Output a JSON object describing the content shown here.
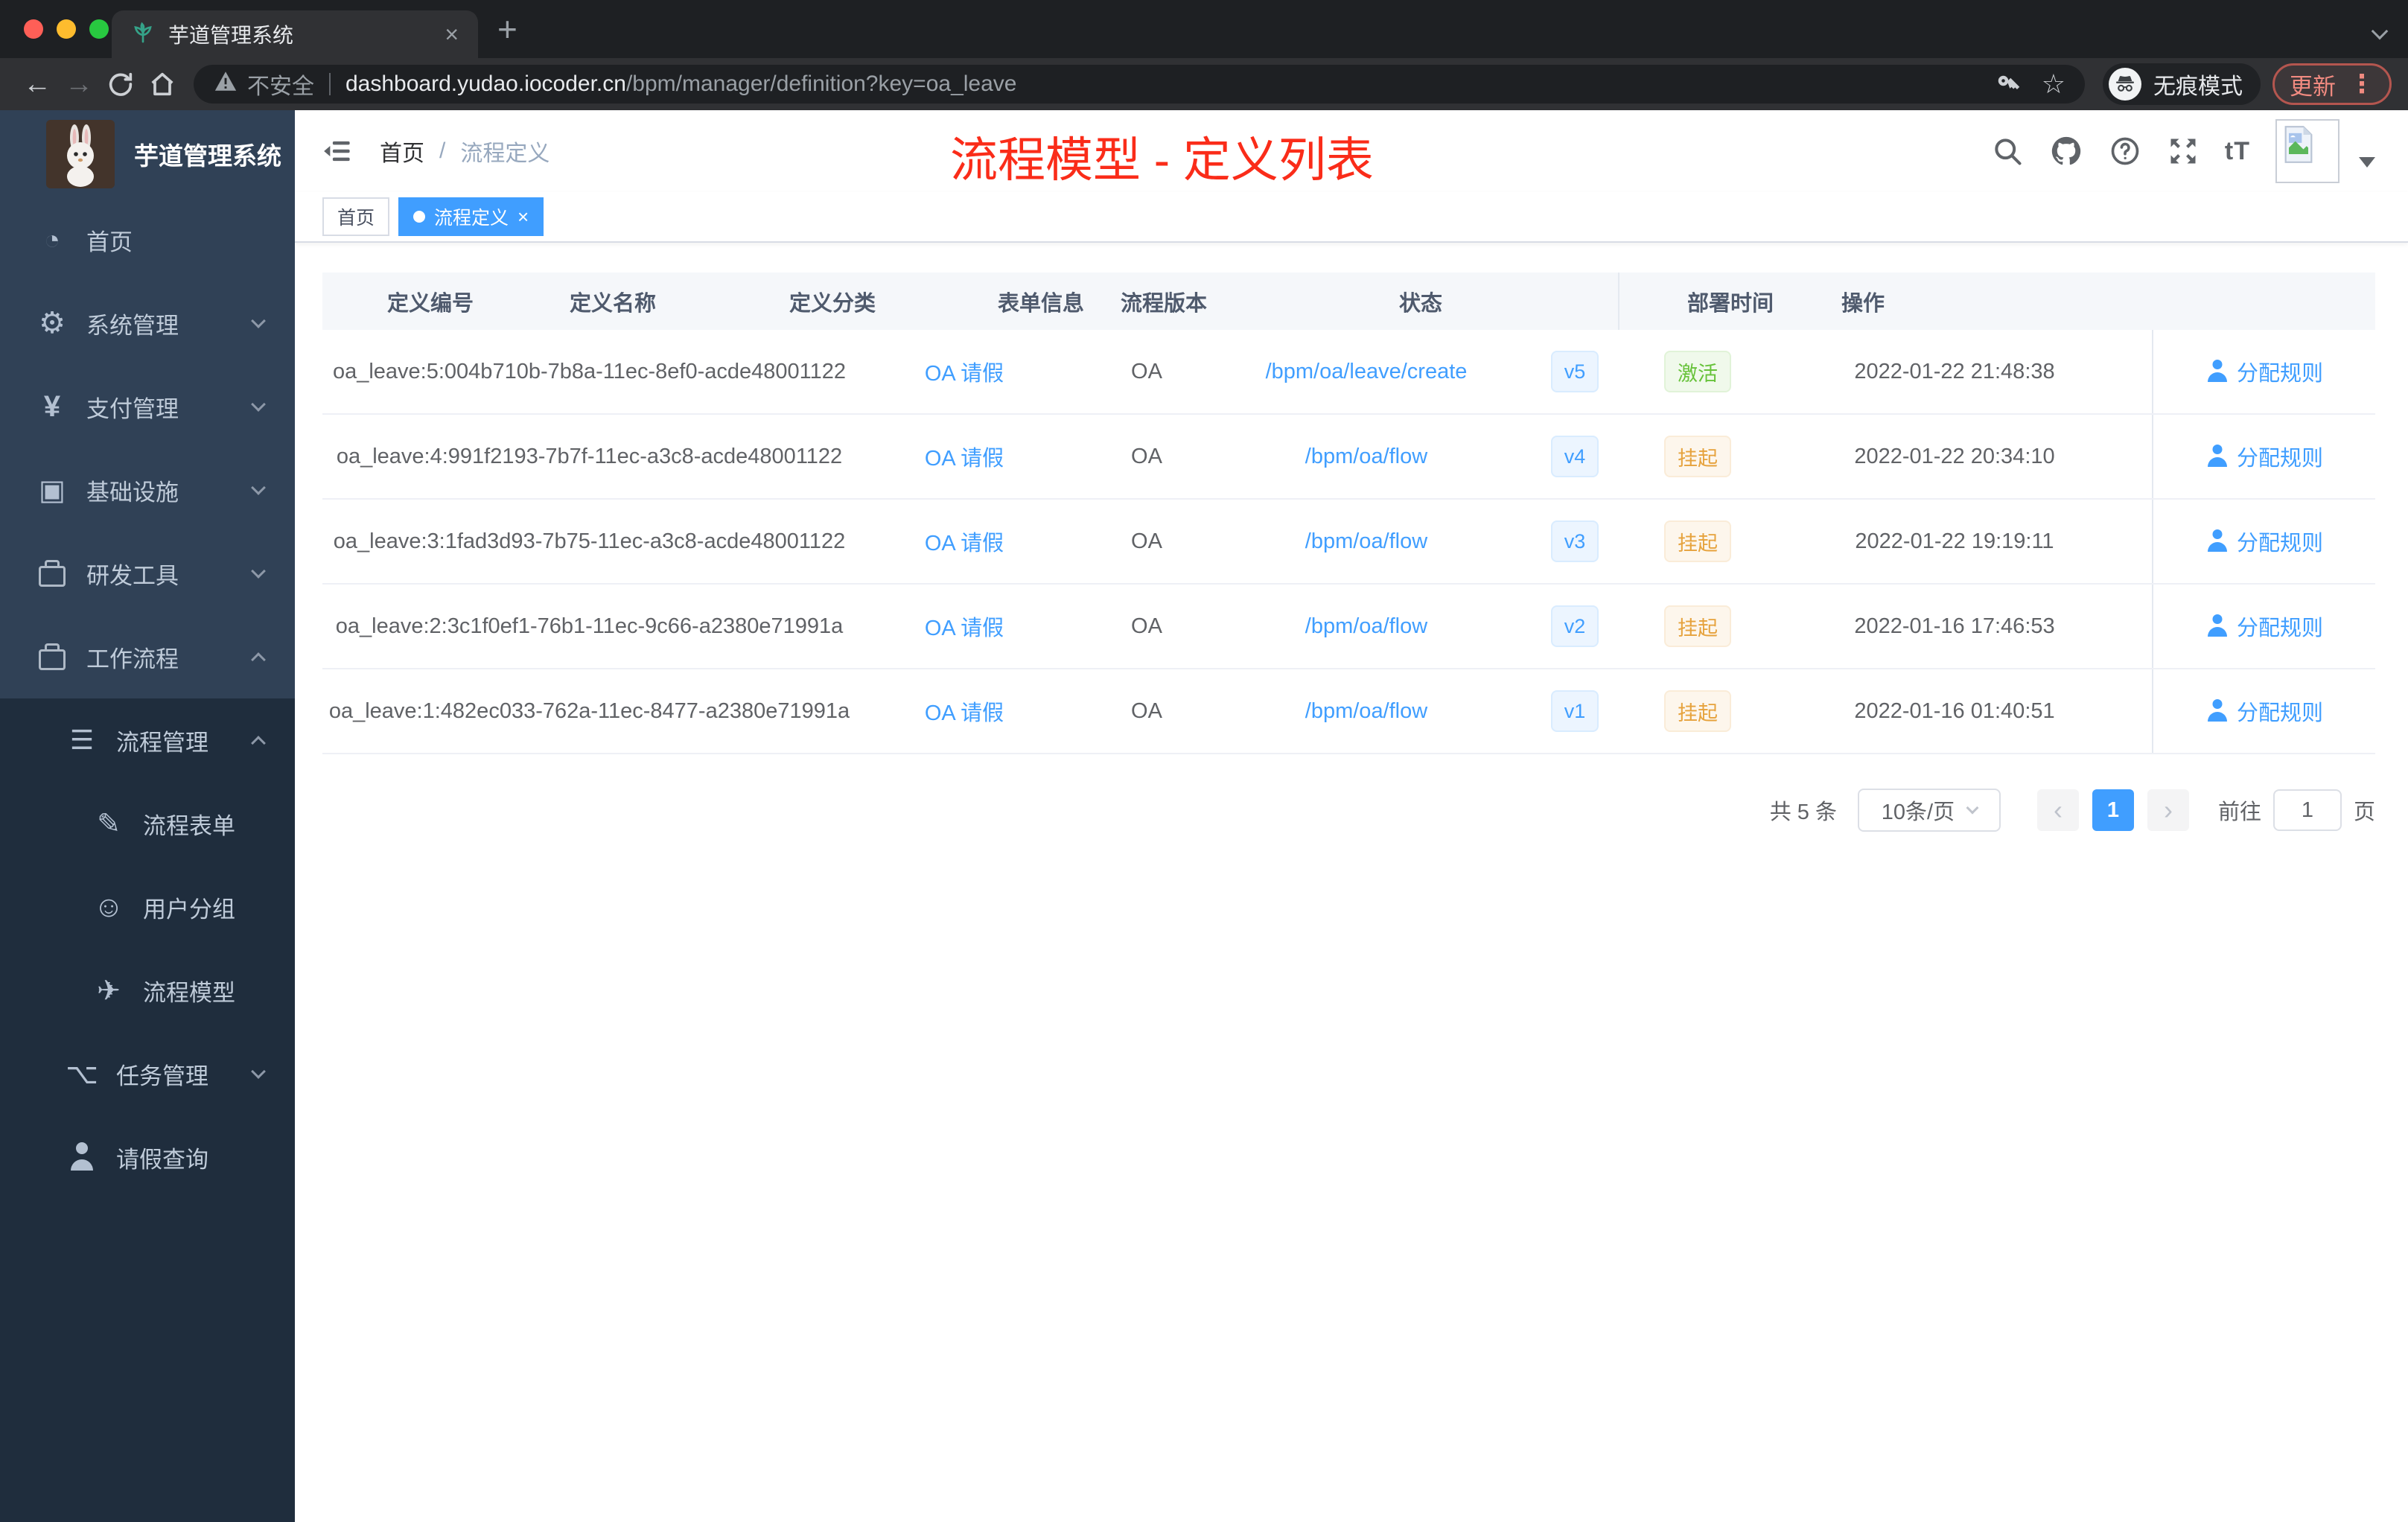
{
  "colors": {
    "accent": "#409eff",
    "link": "#409eff",
    "status_active_green": "#67c23a",
    "status_suspended_orange": "#e6a23c",
    "sidebar_bg": "#304156",
    "submenu_bg": "#1f2d3d",
    "tag_active_bg": "#409eff",
    "annotation_red": "#fa2c19"
  },
  "browser": {
    "tab_title": "芋道管理系统",
    "close_tab": "×",
    "new_tab": "+",
    "security_label": "不安全",
    "url_host": "dashboard.yudao.iocoder.cn",
    "url_path": "/bpm/manager/definition?key=oa_leave",
    "incognito_label": "无痕模式",
    "update_label": "更新",
    "menu_dots": "⋮"
  },
  "sidebar": {
    "logo_title": "芋道管理系统",
    "items": [
      {
        "label": "首页",
        "icon": "dashboard-icon",
        "level": "lvl0"
      },
      {
        "label": "系统管理",
        "icon": "gear-icon",
        "level": "lvl0",
        "chevron": "chevron-down-icon"
      },
      {
        "label": "支付管理",
        "icon": "yen-icon",
        "level": "lvl0",
        "chevron": "chevron-down-icon"
      },
      {
        "label": "基础设施",
        "icon": "monitor-icon",
        "level": "lvl0",
        "chevron": "chevron-down-icon"
      },
      {
        "label": "研发工具",
        "icon": "briefcase-icon",
        "level": "lvl0",
        "chevron": "chevron-down-icon"
      },
      {
        "label": "工作流程",
        "icon": "briefcase-icon",
        "level": "lvl0",
        "chevron": "chevron-up-icon"
      },
      {
        "label": "流程管理",
        "icon": "list-icon",
        "level": "lvl1",
        "section": "sub",
        "chevron": "chevron-up-icon"
      },
      {
        "label": "流程表单",
        "icon": "form-icon",
        "level": "lvl2",
        "section": "sub"
      },
      {
        "label": "用户分组",
        "icon": "robot-icon",
        "level": "lvl2",
        "section": "sub"
      },
      {
        "label": "流程模型",
        "icon": "send-icon",
        "level": "lvl2",
        "section": "sub"
      },
      {
        "label": "任务管理",
        "icon": "tree-icon",
        "level": "lvl1",
        "section": "sub",
        "chevron": "chevron-down-icon"
      },
      {
        "label": "请假查询",
        "icon": "user-icon",
        "level": "lvl1",
        "section": "sub"
      }
    ]
  },
  "header": {
    "breadcrumb_home": "首页",
    "breadcrumb_separator": "/",
    "breadcrumb_current": "流程定义",
    "annotation": "流程模型 - 定义列表",
    "annotation_color": "#fa2c19"
  },
  "tags": [
    {
      "label": "首页"
    },
    {
      "label": "流程定义",
      "state": "active",
      "dot": true,
      "close_label": "×"
    }
  ],
  "table": {
    "columns": [
      "定义编号",
      "定义名称",
      "定义分类",
      "表单信息",
      "流程版本",
      "状态",
      "部署时间",
      "操作"
    ],
    "rows": [
      {
        "id": "oa_leave:5:004b710b-7b8a-11ec-8ef0-acde48001122",
        "name": "OA 请假",
        "category": "OA",
        "form": "/bpm/oa/leave/create",
        "version": "v5",
        "status": "激活",
        "type": "active",
        "deploy_time": "2022-01-22 21:48:38",
        "action": "分配规则"
      },
      {
        "id": "oa_leave:4:991f2193-7b7f-11ec-a3c8-acde48001122",
        "name": "OA 请假",
        "category": "OA",
        "form": "/bpm/oa/flow",
        "version": "v4",
        "status": "挂起",
        "type": "suspended",
        "deploy_time": "2022-01-22 20:34:10",
        "action": "分配规则"
      },
      {
        "id": "oa_leave:3:1fad3d93-7b75-11ec-a3c8-acde48001122",
        "name": "OA 请假",
        "category": "OA",
        "form": "/bpm/oa/flow",
        "version": "v3",
        "status": "挂起",
        "type": "suspended",
        "deploy_time": "2022-01-22 19:19:11",
        "action": "分配规则"
      },
      {
        "id": "oa_leave:2:3c1f0ef1-76b1-11ec-9c66-a2380e71991a",
        "name": "OA 请假",
        "category": "OA",
        "form": "/bpm/oa/flow",
        "version": "v2",
        "status": "挂起",
        "type": "suspended",
        "deploy_time": "2022-01-16 17:46:53",
        "action": "分配规则"
      },
      {
        "id": "oa_leave:1:482ec033-762a-11ec-8477-a2380e71991a",
        "name": "OA 请假",
        "category": "OA",
        "form": "/bpm/oa/flow",
        "version": "v1",
        "status": "挂起",
        "type": "suspended",
        "deploy_time": "2022-01-16 01:40:51",
        "action": "分配规则"
      }
    ]
  },
  "pagination": {
    "total": "共 5 条",
    "page_size": "10条/页",
    "prev": "‹",
    "page": "1",
    "next": "›",
    "goto_label": "前往",
    "goto_value": "1",
    "goto_unit": "页"
  }
}
